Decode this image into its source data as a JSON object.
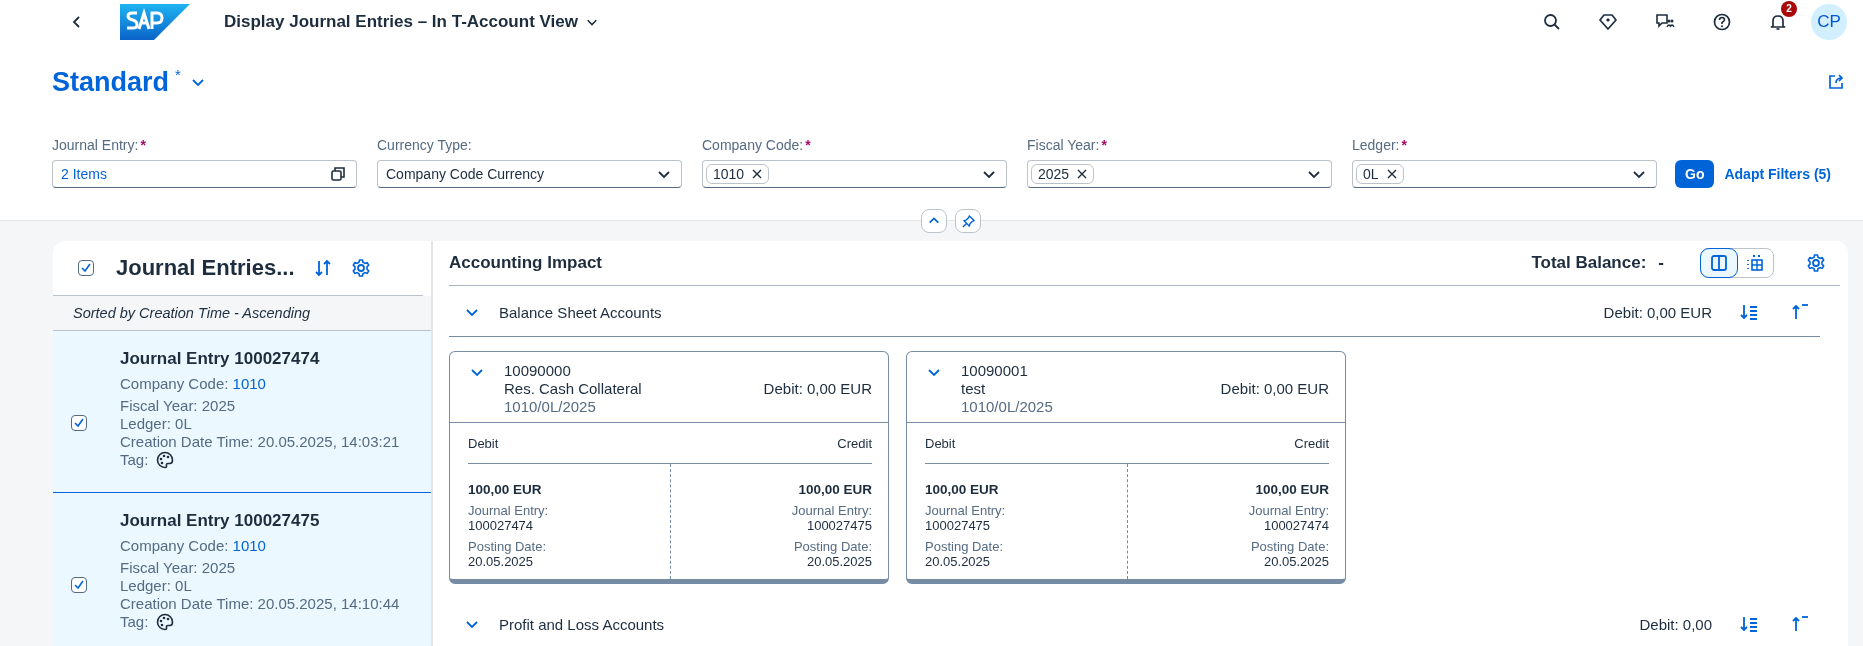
{
  "shell": {
    "title": "Display Journal Entries – In T-Account View",
    "notification_count": "2",
    "avatar": "CP"
  },
  "variant": {
    "name": "Standard",
    "dirty_mark": "*"
  },
  "filters": [
    {
      "label": "Journal Entry:",
      "required": true,
      "kind": "value_help",
      "value": "2 Items"
    },
    {
      "label": "Currency Type:",
      "required": false,
      "kind": "select",
      "value": "Company Code Currency"
    },
    {
      "label": "Company Code:",
      "required": true,
      "kind": "tokens",
      "tokens": [
        "1010"
      ]
    },
    {
      "label": "Fiscal Year:",
      "required": true,
      "kind": "tokens",
      "tokens": [
        "2025"
      ]
    },
    {
      "label": "Ledger:",
      "required": true,
      "kind": "tokens",
      "tokens": [
        "0L"
      ]
    }
  ],
  "filter_actions": {
    "go": "Go",
    "adapt": "Adapt Filters (5)"
  },
  "required_mark": "*",
  "list": {
    "title": "Journal Entries...",
    "select_all_checked": true,
    "sort_info": "Sorted by Creation Time - Ascending",
    "entries": [
      {
        "title": "Journal Entry 100027474",
        "company_code_label": "Company Code:",
        "company_code": "1010",
        "fiscal_year": "Fiscal Year: 2025",
        "ledger": "Ledger: 0L",
        "creation": "Creation Date Time: 20.05.2025, 14:03:21",
        "tag_label": "Tag:",
        "checked": true,
        "selected": true
      },
      {
        "title": "Journal Entry 100027475",
        "company_code_label": "Company Code:",
        "company_code": "1010",
        "fiscal_year": "Fiscal Year: 2025",
        "ledger": "Ledger: 0L",
        "creation": "Creation Date Time: 20.05.2025, 14:10:44",
        "tag_label": "Tag:",
        "checked": true,
        "selected": true
      }
    ]
  },
  "impact": {
    "title": "Accounting Impact",
    "total_balance_label": "Total Balance:",
    "total_balance": "-",
    "view_modes": [
      {
        "kind": "split",
        "selected": true
      },
      {
        "kind": "table",
        "selected": false
      }
    ],
    "sections": [
      {
        "title": "Balance Sheet Accounts",
        "expanded": true,
        "summary": "Debit: 0,00 EUR",
        "accounts": [
          {
            "number": "10090000",
            "name": "Res. Cash Collateral",
            "key": "1010/0L/2025",
            "balance": "Debit: 0,00 EUR",
            "expanded": true,
            "debit_header": "Debit",
            "credit_header": "Credit",
            "debit": [
              {
                "amount": "100,00 EUR",
                "je_label": "Journal Entry:",
                "je": "100027474",
                "pd_label": "Posting Date:",
                "pd": "20.05.2025"
              }
            ],
            "credit": [
              {
                "amount": "100,00 EUR",
                "je_label": "Journal Entry:",
                "je": "100027475",
                "pd_label": "Posting Date:",
                "pd": "20.05.2025"
              }
            ]
          },
          {
            "number": "10090001",
            "name": "test",
            "key": "1010/0L/2025",
            "balance": "Debit: 0,00 EUR",
            "expanded": true,
            "debit_header": "Debit",
            "credit_header": "Credit",
            "debit": [
              {
                "amount": "100,00 EUR",
                "je_label": "Journal Entry:",
                "je": "100027475",
                "pd_label": "Posting Date:",
                "pd": "20.05.2025"
              }
            ],
            "credit": [
              {
                "amount": "100,00 EUR",
                "je_label": "Journal Entry:",
                "je": "100027474",
                "pd_label": "Posting Date:",
                "pd": "20.05.2025"
              }
            ]
          }
        ]
      },
      {
        "title": "Profit and Loss Accounts",
        "expanded": true,
        "summary": "Debit: 0,00"
      }
    ]
  }
}
